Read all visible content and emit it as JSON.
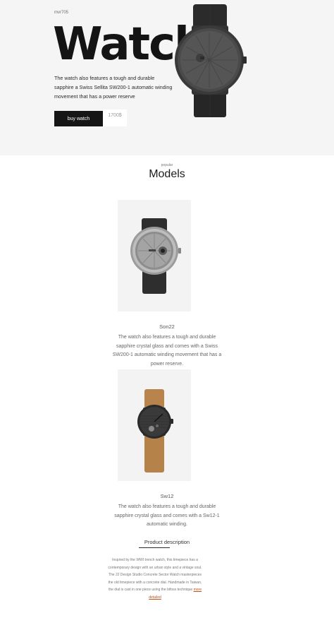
{
  "hero": {
    "brand": "mvr705",
    "title": "Watch",
    "description": "The watch also features a tough and durable sapphire a Swiss Sellita SW200-1 automatic winding movement that has a power reserve",
    "buy_label": "buy watch",
    "price": "1700$"
  },
  "models": {
    "kicker": "popular",
    "title": "Models",
    "items": [
      {
        "name": "Son22",
        "description": "The watch also features a tough and durable sapphire crystal glass and comes with a Swiss SW200-1 automatic winding movement that has a power reserve."
      },
      {
        "name": "Sw12",
        "description": "The watch also features a tough and durable sapphire crystal glass and comes with a Sw12-1 automatic winding."
      }
    ]
  },
  "product": {
    "title": "Product description",
    "text": "Inspired by the WWI trench watch, this timepiece has a contemporary design with an urban style and a vintage soul. The 22 Design Studio Concrete Sector Watch masterpieces the old timepiece with a concrete dial. Handmade in Taiwan, the dial is cast in one piece using the bifoss technique",
    "more_label": "more detailed"
  },
  "colors": {
    "hero_bg": "#f5f5f5",
    "button_bg": "#151515",
    "link": "#c0521a"
  }
}
